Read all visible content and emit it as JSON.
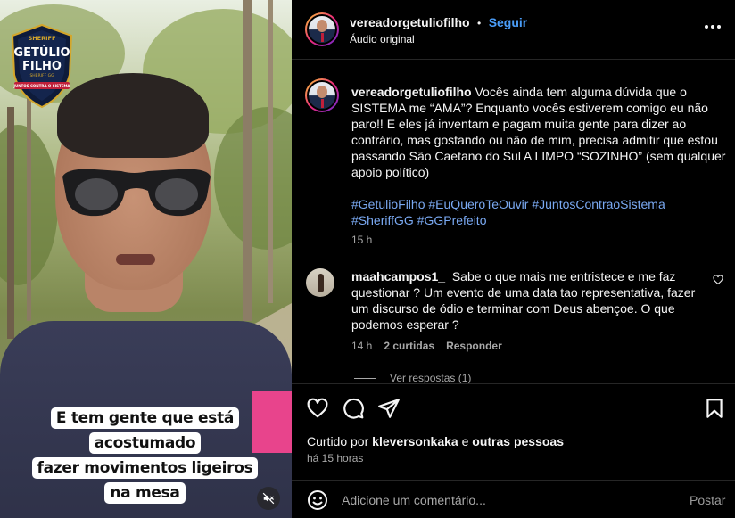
{
  "video": {
    "logo": {
      "top_text": "SHERIFF",
      "name_line1": "GETÚLIO",
      "name_line2": "FILHO",
      "sub_text": "SHERIFF GG",
      "ribbon": "JUNTOS CONTRA O SISTEMA"
    },
    "caption_line1": "E tem gente que está acostumado",
    "caption_line2": "fazer movimentos ligeiros na mesa",
    "mute_icon": "speaker-muted-icon"
  },
  "header": {
    "username": "vereadorgetuliofilho",
    "separator": "•",
    "follow_label": "Seguir",
    "audio_label": "Áudio original",
    "more_icon": "more-options-icon"
  },
  "post_caption": {
    "username": "vereadorgetuliofilho",
    "text": "Vocês ainda tem alguma dúvida que o SISTEMA me “AMA”? Enquanto vocês estiverem comigo eu não paro!! E eles já inventam e pagam muita gente para dizer ao contrário, mas gostando ou não de mim, precisa admitir que estou passando São Caetano do Sul A LIMPO “SOZINHO” (sem qualquer apoio político)",
    "hashtags": [
      "#GetulioFilho",
      "#EuQueroTeOuvir",
      "#JuntosContraoSistema",
      "#SheriffGG",
      "#GGPrefeito"
    ],
    "time": "15 h"
  },
  "comment": {
    "username": "maahcampos1_",
    "text": "Sabe o que mais me entristece e me faz questionar ? Um evento de uma data tao representativa, fazer um discurso de ódio e terminar com Deus abençoe. O que podemos esperar ?",
    "time": "14 h",
    "likes": "2 curtidas",
    "reply_label": "Responder",
    "view_replies": "Ver respostas (1)"
  },
  "actions": {
    "liked_by_prefix": "Curtido por",
    "liked_by_user": "kleversonkaka",
    "liked_by_and": "e",
    "liked_by_others": "outras pessoas",
    "posted_ago": "há 15 horas"
  },
  "composer": {
    "placeholder": "Adicione um comentário...",
    "post_label": "Postar"
  }
}
